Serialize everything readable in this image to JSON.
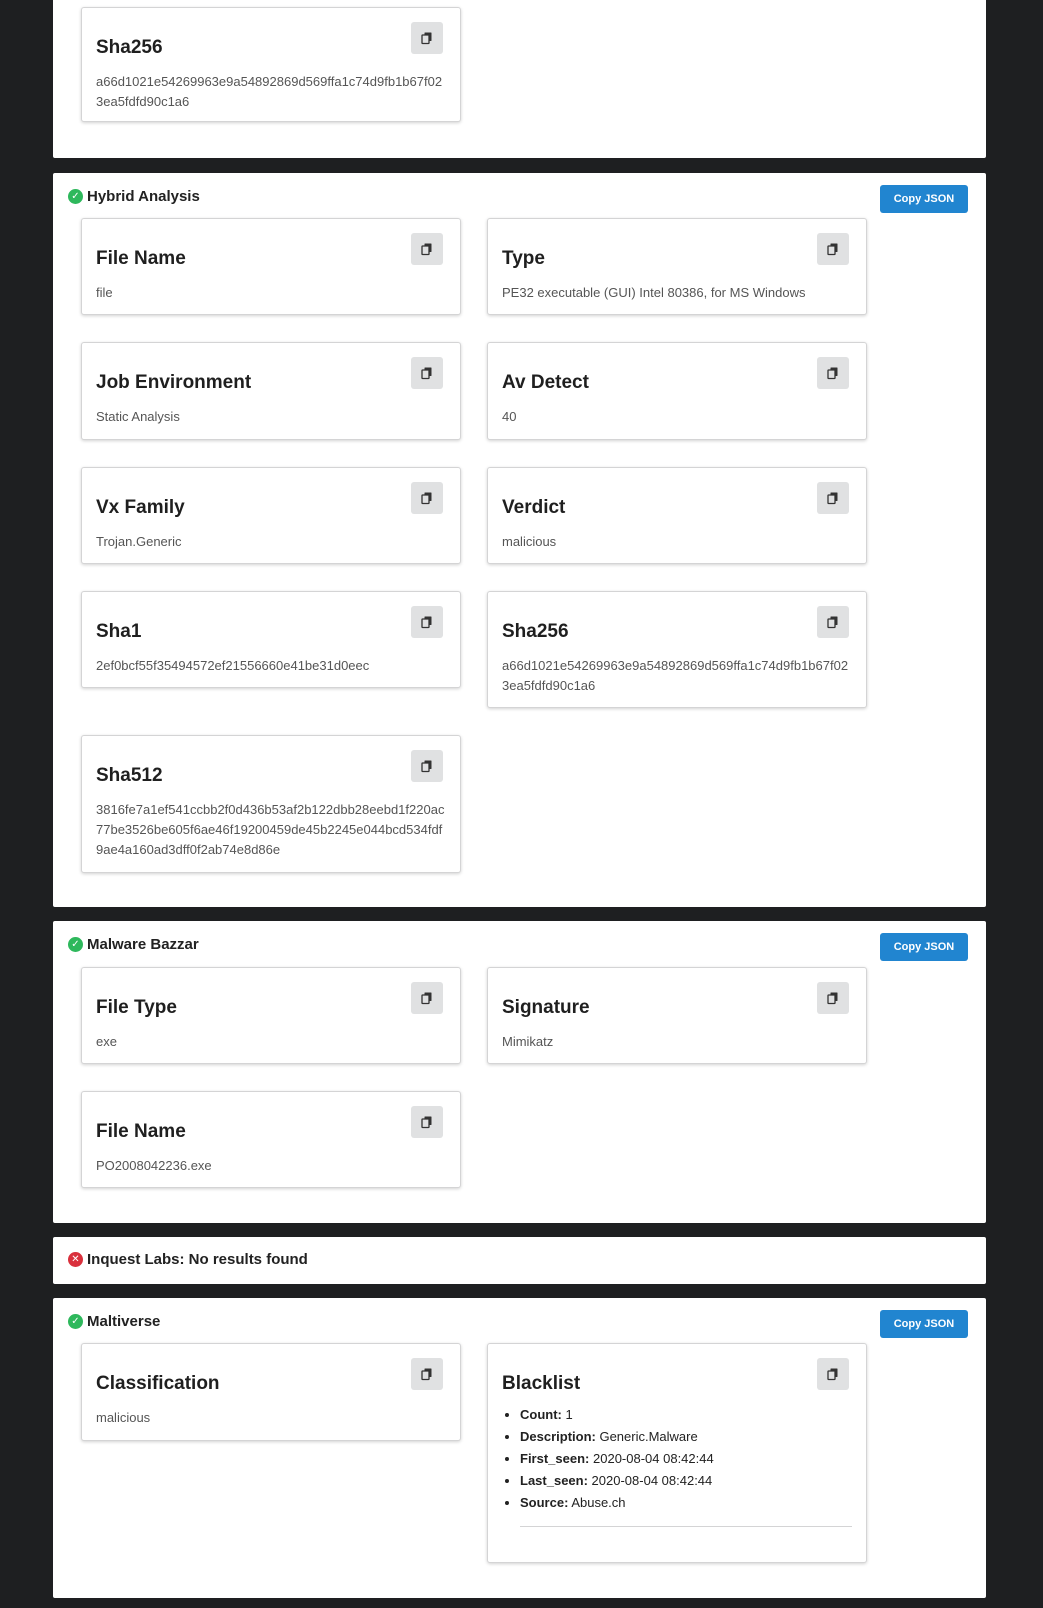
{
  "top_panel": {
    "cards": [
      {
        "title": "Sha256",
        "value": "a66d1021e54269963e9a54892869d569ffa1c74d9fb1b67f023ea5fdfd90c1a6"
      }
    ]
  },
  "hybrid_analysis": {
    "title": "Hybrid Analysis",
    "status": "success",
    "copy_json_label": "Copy JSON",
    "cards": [
      {
        "title": "File Name",
        "value": "file"
      },
      {
        "title": "Type",
        "value": "PE32 executable (GUI) Intel 80386, for MS Windows"
      },
      {
        "title": "Job Environment",
        "value": "Static Analysis"
      },
      {
        "title": "Av Detect",
        "value": "40"
      },
      {
        "title": "Vx Family",
        "value": "Trojan.Generic"
      },
      {
        "title": "Verdict",
        "value": "malicious"
      },
      {
        "title": "Sha1",
        "value": "2ef0bcf55f35494572ef21556660e41be31d0eec"
      },
      {
        "title": "Sha256",
        "value": "a66d1021e54269963e9a54892869d569ffa1c74d9fb1b67f023ea5fdfd90c1a6"
      },
      {
        "title": "Sha512",
        "value": "3816fe7a1ef541ccbb2f0d436b53af2b122dbb28eebd1f220ac77be3526be605f6ae46f19200459de45b2245e044bcd534fdf9ae4a160ad3dff0f2ab74e8d86e"
      }
    ]
  },
  "malware_bazzar": {
    "title": "Malware Bazzar",
    "status": "success",
    "copy_json_label": "Copy JSON",
    "cards": [
      {
        "title": "File Type",
        "value": "exe"
      },
      {
        "title": "Signature",
        "value": "Mimikatz"
      },
      {
        "title": "File Name",
        "value": "PO2008042236.exe"
      }
    ]
  },
  "inquest_labs": {
    "title": "Inquest Labs: No results found",
    "status": "error"
  },
  "maltiverse": {
    "title": "Maltiverse",
    "status": "success",
    "copy_json_label": "Copy JSON",
    "classification": {
      "title": "Classification",
      "value": "malicious"
    },
    "blacklist": {
      "title": "Blacklist",
      "items": [
        {
          "key": "Count:",
          "value": "1"
        },
        {
          "key": "Description:",
          "value": "Generic.Malware"
        },
        {
          "key": "First_seen:",
          "value": "2020-08-04 08:42:44"
        },
        {
          "key": "Last_seen:",
          "value": "2020-08-04 08:42:44"
        },
        {
          "key": "Source:",
          "value": "Abuse.ch"
        }
      ]
    }
  },
  "icons": {
    "copy": "copy-icon",
    "check": "check-circle-icon",
    "error": "x-circle-icon"
  }
}
